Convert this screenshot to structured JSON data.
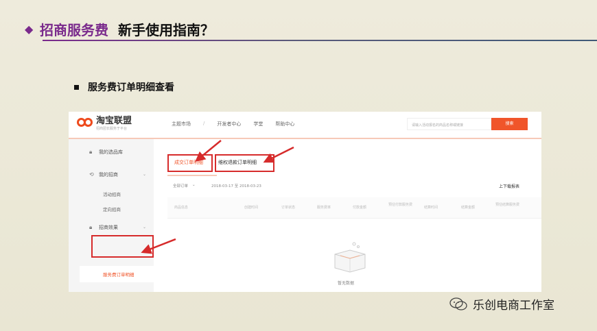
{
  "slide": {
    "title_colored": "招商服务费",
    "title_main": "新手使用指南？",
    "bullet": "服务费订单明细查看"
  },
  "screenshot": {
    "logo_name": "淘宝联盟",
    "logo_slogan": "招商团长服务于平台",
    "nav": [
      "主题市场",
      "开发者中心",
      "学堂",
      "帮助中心"
    ],
    "search_placeholder": "请输入活动报名的商品名称或链接",
    "search_button": "搜索",
    "sidebar": {
      "item_lib": "我的选品库",
      "item_my": "我的招商",
      "sub_activity": "活动招商",
      "sub_directed": "定向招商",
      "item_effect": "招商效果",
      "active_item": "服务费订单明细"
    },
    "tabs": [
      "成交订单明细",
      "维权退款订单明细"
    ],
    "filter_all": "全部订单",
    "date_range": "2018-03-17 至 2018-03-23",
    "download": "上下载报表",
    "table_headers": [
      "商品信息",
      "创建时间",
      "订单状态",
      "服务费率",
      "付款金额",
      "预估付款服务费",
      "结算时间",
      "结算金额",
      "预估结算服务费"
    ],
    "empty_text": "暂无数据"
  },
  "watermark": "乐创电商工作室",
  "colors": {
    "accent": "#7a2a8c",
    "taobao_orange": "#f0552a",
    "highlight_red": "#d62b2b"
  }
}
